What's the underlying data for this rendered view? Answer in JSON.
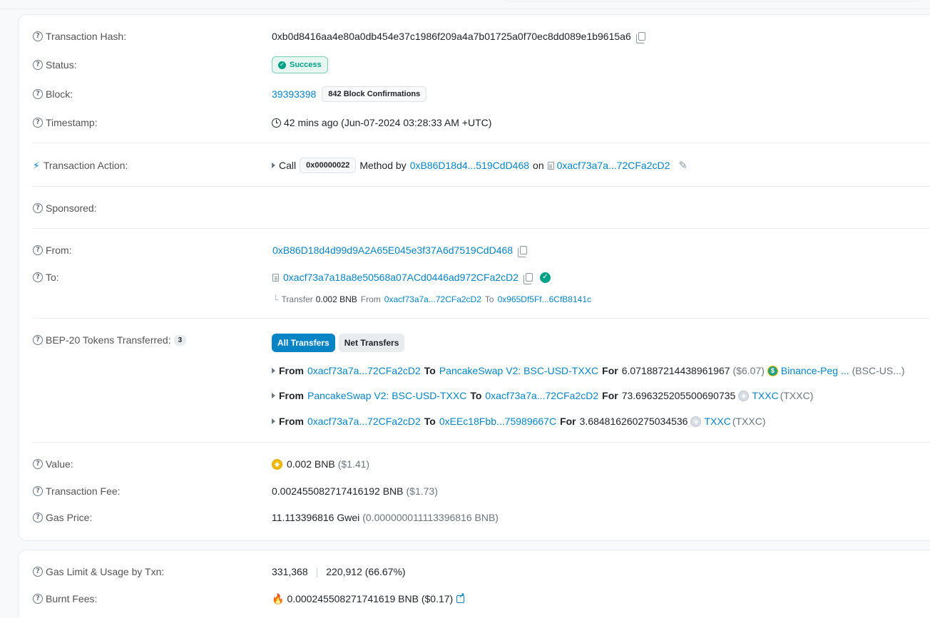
{
  "overview": {
    "tx_hash": {
      "label": "Transaction Hash:",
      "value": "0xb0d8416aa4e80a0db454e37c1986f209a4a7b01725a0f70ec8dd089e1b9615a6"
    },
    "status": {
      "label": "Status:",
      "value": "Success"
    },
    "block": {
      "label": "Block:",
      "number": "39393398",
      "confirmations": "842 Block Confirmations"
    },
    "timestamp": {
      "label": "Timestamp:",
      "value": "42 mins ago (Jun-07-2024 03:28:33 AM +UTC)"
    },
    "action": {
      "label": "Transaction Action:",
      "call": "Call",
      "method": "0x00000022",
      "method_by": "Method by",
      "sender": "0xB86D18d4...519CdD468",
      "on": "on",
      "contract": "0xacf73a7a...72CFa2cD2"
    },
    "sponsored": {
      "label": "Sponsored:"
    },
    "from": {
      "label": "From:",
      "value": "0xB86D18d4d99d9A2A65E045e3f37A6d7519CdD468"
    },
    "to": {
      "label": "To:",
      "value": "0xacf73a7a18a8e50568a07ACd0446ad972CFa2cD2",
      "internal": {
        "prefix": "Transfer",
        "amount": "0.002 BNB",
        "from_word": "From",
        "from": "0xacf73a7a...72CFa2cD2",
        "to_word": "To",
        "to": "0x965Df5Ff...6CfB8141c"
      }
    },
    "tokens": {
      "label": "BEP-20 Tokens Transferred:",
      "count": "3",
      "tab_all": "All Transfers",
      "tab_net": "Net Transfers",
      "transfers": [
        {
          "from_word": "From",
          "from": "0xacf73a7a...72CFa2cD2",
          "to_word": "To",
          "to": "PancakeSwap V2: BSC-USD-TXXC",
          "for_word": "For",
          "amount": "6.071887214438961967",
          "usd": "($6.07)",
          "token": "Binance-Peg ...",
          "symbol": "(BSC-US...)"
        },
        {
          "from_word": "From",
          "from": "PancakeSwap V2: BSC-USD-TXXC",
          "to_word": "To",
          "to": "0xacf73a7a...72CFa2cD2",
          "for_word": "For",
          "amount": "73.696325205500690735",
          "usd": "",
          "token": "TXXC",
          "symbol": "(TXXC)"
        },
        {
          "from_word": "From",
          "from": "0xacf73a7a...72CFa2cD2",
          "to_word": "To",
          "to": "0xEEc18Fbb...75989667C",
          "for_word": "For",
          "amount": "3.684816260275034536",
          "usd": "",
          "token": "TXXC",
          "symbol": "(TXXC)"
        }
      ]
    },
    "value": {
      "label": "Value:",
      "amount": "0.002 BNB",
      "usd": "($1.41)"
    },
    "fee": {
      "label": "Transaction Fee:",
      "amount": "0.002455082717416192 BNB",
      "usd": "($1.73)"
    },
    "gas_price": {
      "label": "Gas Price:",
      "amount": "11.113396816 Gwei",
      "bnb": "(0.000000011113396816 BNB)"
    }
  },
  "gas": {
    "limit": {
      "label": "Gas Limit & Usage by Txn:",
      "limit": "331,368",
      "sep": "|",
      "used": "220,912 (66.67%)"
    },
    "burnt": {
      "label": "Burnt Fees:",
      "amount": "0.000245508271741619 BNB ($0.17)"
    }
  },
  "icons": {
    "question": "?",
    "bolt": "⚡",
    "check": "✓",
    "fire": "🔥",
    "pencil": "✎",
    "usd": "$",
    "txxc": "◈"
  }
}
